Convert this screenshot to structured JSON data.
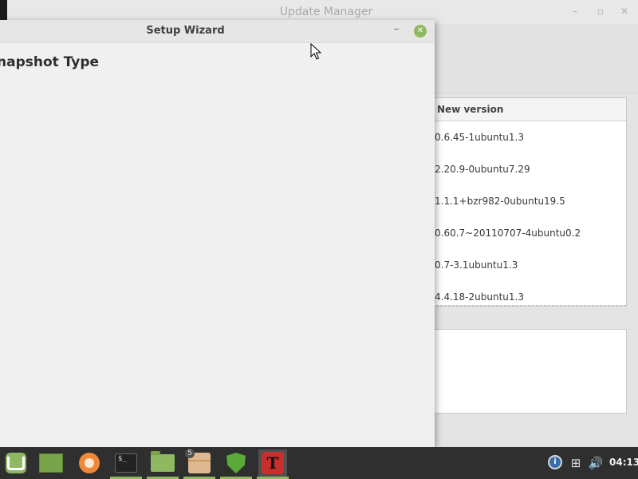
{
  "update_manager": {
    "title": "Update Manager",
    "controls": {
      "minimize": "–",
      "maximize": "▫",
      "close": "✕"
    },
    "table": {
      "header": "New version",
      "rows": [
        "0.6.45-1ubuntu1.3",
        "2.20.9-0ubuntu7.29",
        "1.1.1+bzr982-0ubuntu19.5",
        "0.60.7~20110707-4ubuntu0.2",
        "0.7-3.1ubuntu1.3",
        "4.4.18-2ubuntu1.3"
      ]
    }
  },
  "setup_wizard": {
    "title": "Setup Wizard",
    "minimize": "–",
    "close": "✕",
    "heading": "napshot Type"
  },
  "taskbar": {
    "terminal_text": "$_",
    "box_badge": "5",
    "timeshift_letter": "T",
    "tray": {
      "info": "i",
      "network": "⊞",
      "volume": "🔊"
    },
    "clock": "04:13"
  },
  "colors": {
    "accent": "#8fb860",
    "taskbar": "#2f2f2f",
    "timeshift": "#c8302e"
  }
}
